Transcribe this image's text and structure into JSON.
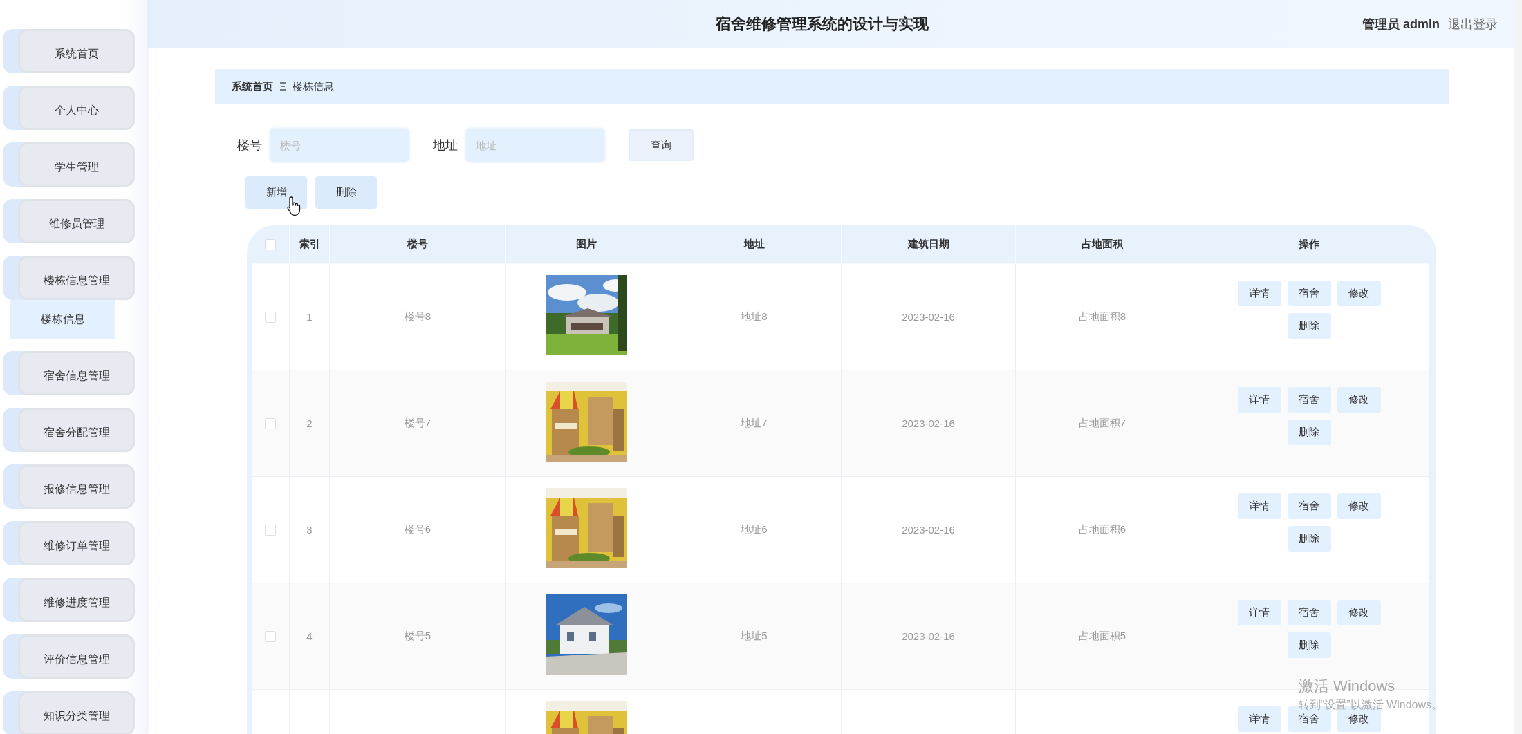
{
  "sidebar": {
    "items": [
      {
        "label": "系统首页",
        "expanded": false
      },
      {
        "label": "个人中心",
        "expanded": false
      },
      {
        "label": "学生管理",
        "expanded": false
      },
      {
        "label": "维修员管理",
        "expanded": false
      },
      {
        "label": "楼栋信息管理",
        "expanded": true,
        "children": [
          {
            "label": "楼栋信息",
            "selected": true
          }
        ]
      },
      {
        "label": "宿舍信息管理",
        "expanded": false
      },
      {
        "label": "宿舍分配管理",
        "expanded": false
      },
      {
        "label": "报修信息管理",
        "expanded": false
      },
      {
        "label": "维修订单管理",
        "expanded": false
      },
      {
        "label": "维修进度管理",
        "expanded": false
      },
      {
        "label": "评价信息管理",
        "expanded": false
      },
      {
        "label": "知识分类管理",
        "expanded": false
      }
    ]
  },
  "header": {
    "title": "宿舍维修管理系统的设计与实现",
    "user_role": "管理员",
    "user_name": "admin",
    "logout": "退出登录"
  },
  "breadcrumb": {
    "home": "系统首页",
    "current": "楼栋信息"
  },
  "search": {
    "fields": [
      {
        "label": "楼号",
        "placeholder": "楼号"
      },
      {
        "label": "地址",
        "placeholder": "地址"
      }
    ],
    "button": "查询"
  },
  "toolbar": [
    "新增",
    "删除"
  ],
  "table": {
    "select_all": {
      "checked": false
    },
    "columns": [
      "索引",
      "楼号",
      "图片",
      "地址",
      "建筑日期",
      "占地面积",
      "操作"
    ],
    "rows": [
      {
        "checked": false,
        "index": "1",
        "number": "楼号8",
        "picture": {
          "kind": "picture"
        },
        "address": "地址8",
        "date": "2023-02-16",
        "area": "占地面积8",
        "actions": [
          "详情",
          "宿舍",
          "修改",
          "删除"
        ]
      },
      {
        "checked": false,
        "index": "2",
        "number": "楼号7",
        "picture": {
          "kind": "picture"
        },
        "address": "地址7",
        "date": "2023-02-16",
        "area": "占地面积7",
        "actions": [
          "详情",
          "宿舍",
          "修改",
          "删除"
        ]
      },
      {
        "checked": false,
        "index": "3",
        "number": "楼号6",
        "picture": {
          "kind": "picture"
        },
        "address": "地址6",
        "date": "2023-02-16",
        "area": "占地面积6",
        "actions": [
          "详情",
          "宿舍",
          "修改",
          "删除"
        ]
      },
      {
        "checked": false,
        "index": "4",
        "number": "楼号5",
        "picture": {
          "kind": "picture"
        },
        "address": "地址5",
        "date": "2023-02-16",
        "area": "占地面积5",
        "actions": [
          "详情",
          "宿舍",
          "修改",
          "删除"
        ]
      },
      {
        "picture": {
          "kind": "picture"
        },
        "actions": [
          "详情",
          "宿舍",
          "修改"
        ]
      }
    ]
  },
  "os_notice": {
    "title": "激活 Windows",
    "message": "转到“设置”以激活 Windows。"
  }
}
